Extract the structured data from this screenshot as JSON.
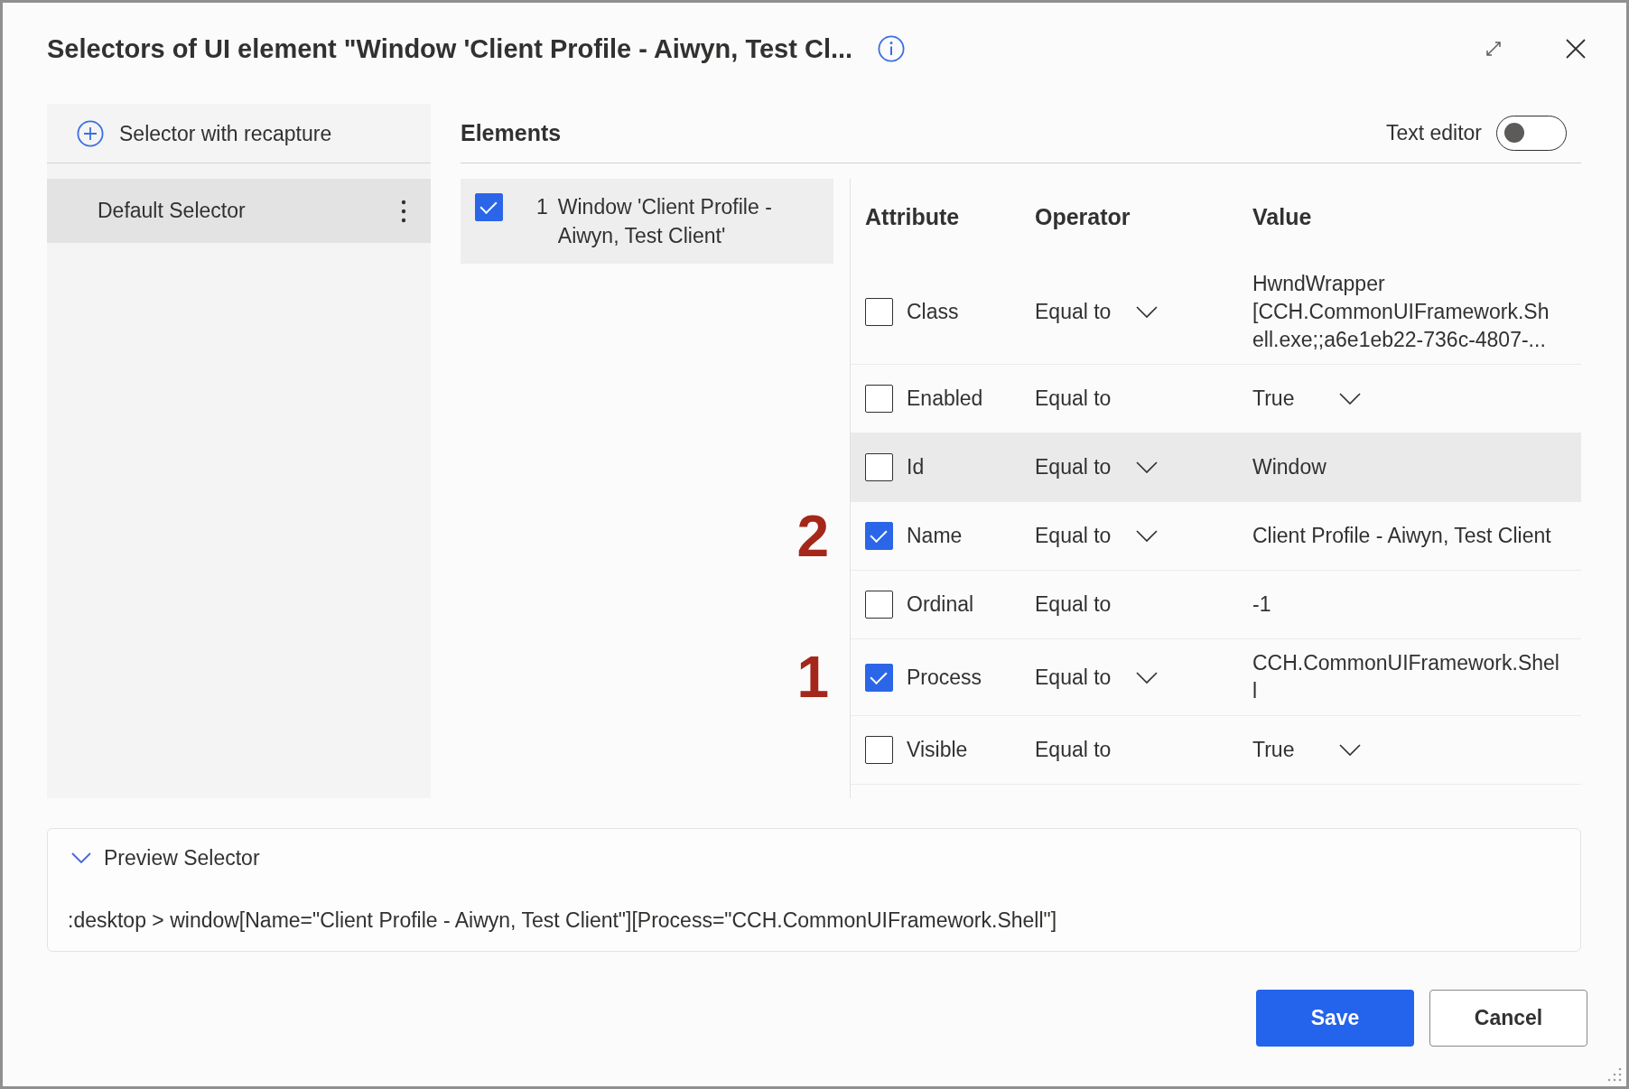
{
  "window": {
    "title": "Selectors of UI element \"Window 'Client Profile - Aiwyn, Test Cl..."
  },
  "selectors": {
    "add_button": "Selector with recapture",
    "items": [
      {
        "label": "Default Selector",
        "selected": true
      }
    ]
  },
  "elements": {
    "heading": "Elements",
    "text_editor": {
      "label": "Text editor",
      "on": false
    },
    "items": [
      {
        "index": "1",
        "label": "Window 'Client Profile - Aiwyn, Test Client'",
        "checked": true,
        "selected": true
      }
    ]
  },
  "attributes": {
    "columns": [
      "Attribute",
      "Operator",
      "Value"
    ],
    "rows": [
      {
        "name": "Class",
        "checked": false,
        "operator": "Equal to",
        "operator_dropdown": true,
        "value": "HwndWrapper [CCH.CommonUIFramework.Shell.exe;;a6e1eb22-736c-4807-...",
        "value_dropdown": false,
        "highlighted": false
      },
      {
        "name": "Enabled",
        "checked": false,
        "operator": "Equal to",
        "operator_dropdown": false,
        "value": "True",
        "value_dropdown": true,
        "highlighted": false
      },
      {
        "name": "Id",
        "checked": false,
        "operator": "Equal to",
        "operator_dropdown": true,
        "value": "Window",
        "value_dropdown": false,
        "highlighted": true
      },
      {
        "name": "Name",
        "checked": true,
        "operator": "Equal to",
        "operator_dropdown": true,
        "value": "Client Profile - Aiwyn, Test Client",
        "value_dropdown": false,
        "highlighted": false,
        "marker": "2"
      },
      {
        "name": "Ordinal",
        "checked": false,
        "operator": "Equal to",
        "operator_dropdown": false,
        "value": "-1",
        "value_dropdown": false,
        "highlighted": false
      },
      {
        "name": "Process",
        "checked": true,
        "operator": "Equal to",
        "operator_dropdown": true,
        "value": "CCH.CommonUIFramework.Shell",
        "value_dropdown": false,
        "highlighted": false,
        "marker": "1"
      },
      {
        "name": "Visible",
        "checked": false,
        "operator": "Equal to",
        "operator_dropdown": false,
        "value": "True",
        "value_dropdown": true,
        "highlighted": false
      }
    ]
  },
  "preview": {
    "title": "Preview Selector",
    "expanded": true,
    "selector": ":desktop > window[Name=\"Client Profile - Aiwyn, Test Client\"][Process=\"CCH.CommonUIFramework.Shell\"]"
  },
  "buttons": [
    {
      "label": "Save",
      "kind": "primary"
    },
    {
      "label": "Cancel",
      "kind": "secondary"
    }
  ]
}
